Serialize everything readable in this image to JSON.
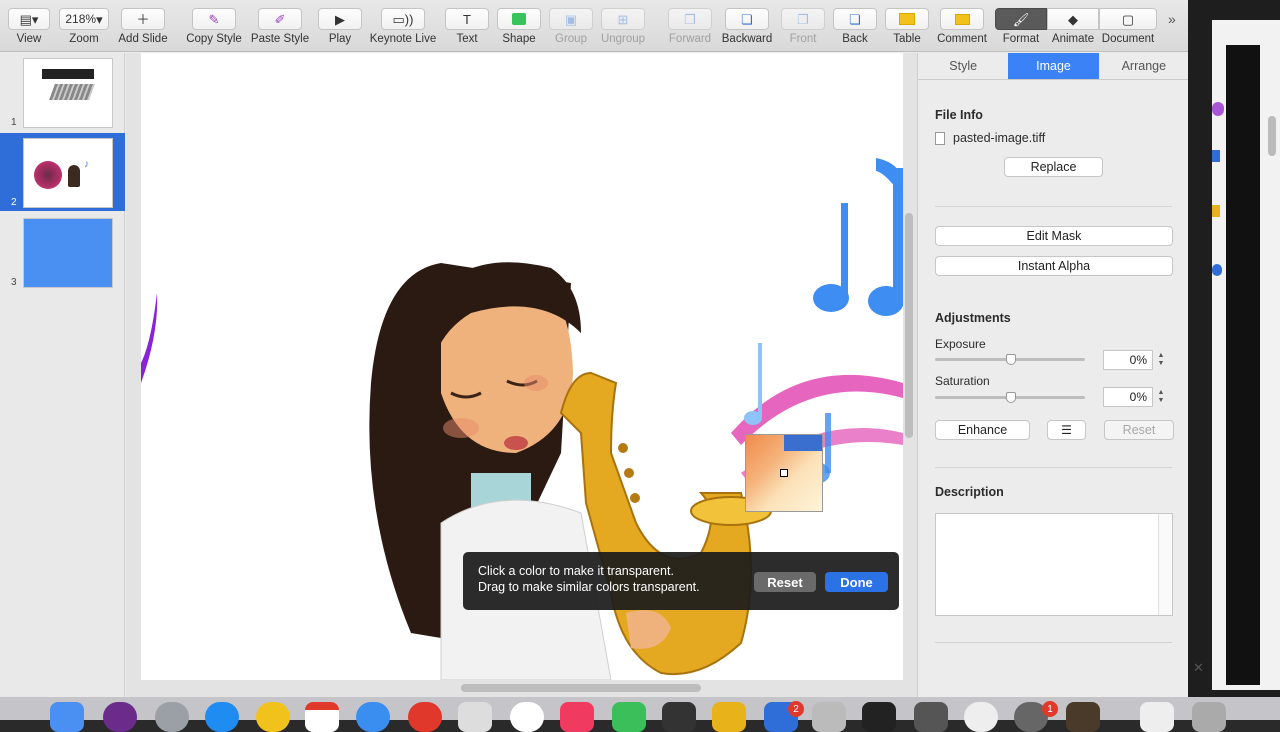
{
  "toolbar": {
    "view": "View",
    "zoom": "Zoom",
    "zoom_value": "218%",
    "add_slide": "Add Slide",
    "copy_style": "Copy Style",
    "paste_style": "Paste Style",
    "play": "Play",
    "keynote_live": "Keynote Live",
    "text": "Text",
    "shape": "Shape",
    "group": "Group",
    "ungroup": "Ungroup",
    "forward": "Forward",
    "backward": "Backward",
    "front": "Front",
    "back": "Back",
    "table": "Table",
    "comment": "Comment",
    "format": "Format",
    "animate": "Animate",
    "document": "Document"
  },
  "navigator": {
    "slides": [
      {
        "number": "1"
      },
      {
        "number": "2"
      },
      {
        "number": "3"
      }
    ]
  },
  "instant_alpha": {
    "line1": "Click a color to make it transparent.",
    "line2": "Drag to make similar colors transparent.",
    "reset": "Reset",
    "done": "Done"
  },
  "inspector": {
    "tabs": [
      "Style",
      "Image",
      "Arrange"
    ],
    "file_info_title": "File Info",
    "file_name": "pasted-image.tiff",
    "replace": "Replace",
    "edit_mask": "Edit Mask",
    "instant_alpha": "Instant Alpha",
    "adjustments_title": "Adjustments",
    "exposure_label": "Exposure",
    "exposure_value": "0%",
    "saturation_label": "Saturation",
    "saturation_value": "0%",
    "enhance": "Enhance",
    "reset": "Reset",
    "description_title": "Description"
  },
  "dock": {
    "badges": [
      "2",
      "1"
    ]
  },
  "colors": {
    "accent": "#3a82f6",
    "nav_selected": "#2f6ed9",
    "done_button": "#2b72e6"
  }
}
